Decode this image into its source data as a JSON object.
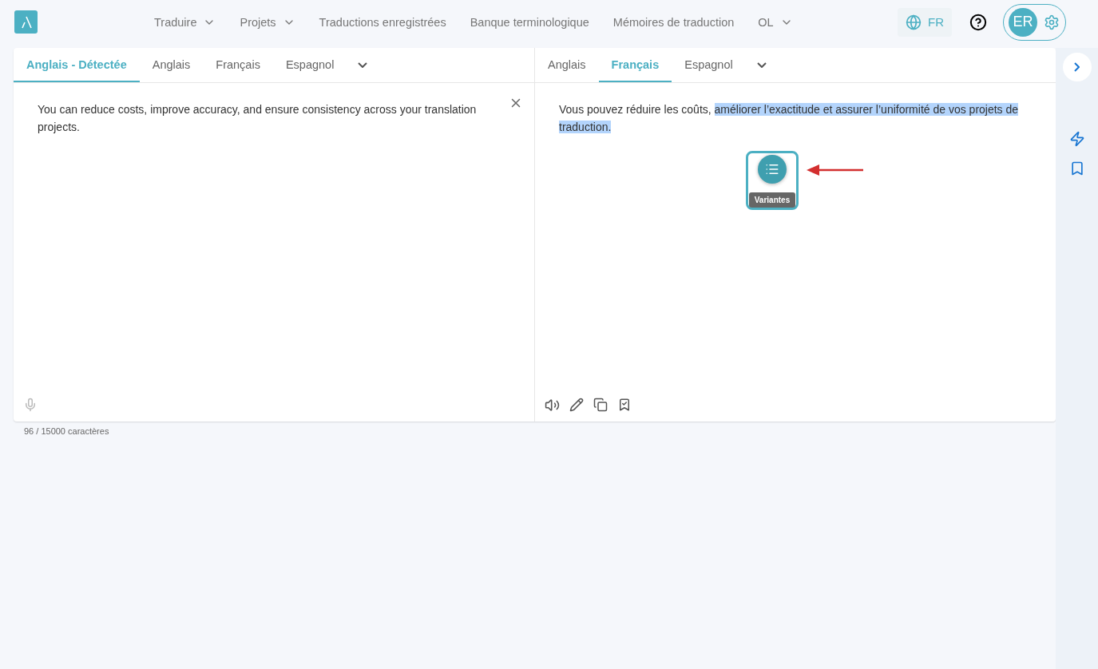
{
  "nav": {
    "items": [
      {
        "label": "Traduire",
        "dropdown": true
      },
      {
        "label": "Projets",
        "dropdown": true
      },
      {
        "label": "Traductions enregistrées",
        "dropdown": false
      },
      {
        "label": "Banque terminologique",
        "dropdown": false
      },
      {
        "label": "Mémoires de traduction",
        "dropdown": false
      },
      {
        "label": "OL",
        "dropdown": true
      }
    ],
    "language": "FR",
    "avatar": "ER"
  },
  "source": {
    "tabs": [
      {
        "label": "Anglais - Détectée",
        "selected": true
      },
      {
        "label": "Anglais",
        "selected": false
      },
      {
        "label": "Français",
        "selected": false
      },
      {
        "label": "Espagnol",
        "selected": false
      }
    ],
    "text": "You can reduce costs, improve accuracy, and ensure consistency across your translation projects.",
    "counter": "96 / 15000 caractères"
  },
  "target": {
    "tabs": [
      {
        "label": "Anglais",
        "selected": false
      },
      {
        "label": "Français",
        "selected": true
      },
      {
        "label": "Espagnol",
        "selected": false
      }
    ],
    "segments": [
      {
        "text": "Vous pouvez réduire les coûts, ",
        "selected": false
      },
      {
        "text": "améliorer l’exactitude et assurer l’uniformité de vos projets de traduction.",
        "selected": true
      }
    ],
    "popup": {
      "tooltip": "Variantes"
    }
  }
}
